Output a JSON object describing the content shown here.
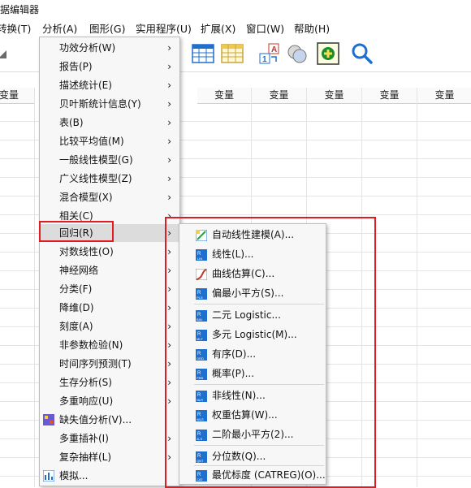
{
  "window": {
    "title": "据编辑器"
  },
  "menubar": {
    "items": [
      "转换(T)",
      "分析(A)",
      "图形(G)",
      "实用程序(U)",
      "扩展(X)",
      "窗口(W)",
      "帮助(H)"
    ]
  },
  "grid": {
    "columns": [
      "变量",
      "变量",
      "变量",
      "变量",
      "变量",
      "变量"
    ]
  },
  "analyze_menu": {
    "items": [
      {
        "label": "功效分析(W)",
        "submenu": true
      },
      {
        "label": "报告(P)",
        "submenu": true
      },
      {
        "label": "描述统计(E)",
        "submenu": true
      },
      {
        "label": "贝叶斯统计信息(Y)",
        "submenu": true
      },
      {
        "label": "表(B)",
        "submenu": true
      },
      {
        "label": "比较平均值(M)",
        "submenu": true
      },
      {
        "label": "一般线性模型(G)",
        "submenu": true
      },
      {
        "label": "广义线性模型(Z)",
        "submenu": true
      },
      {
        "label": "混合模型(X)",
        "submenu": true
      },
      {
        "label": "相关(C)",
        "submenu": true
      },
      {
        "label": "回归(R)",
        "submenu": true,
        "highlighted": true
      },
      {
        "label": "对数线性(O)",
        "submenu": true
      },
      {
        "label": "神经网络",
        "submenu": true
      },
      {
        "label": "分类(F)",
        "submenu": true
      },
      {
        "label": "降维(D)",
        "submenu": true
      },
      {
        "label": "刻度(A)",
        "submenu": true
      },
      {
        "label": "非参数检验(N)",
        "submenu": true
      },
      {
        "label": "时间序列预测(T)",
        "submenu": true
      },
      {
        "label": "生存分析(S)",
        "submenu": true
      },
      {
        "label": "多重响应(U)",
        "submenu": true
      },
      {
        "label": "缺失值分析(V)...",
        "submenu": false,
        "icon": "missing-values-icon"
      },
      {
        "label": "多重插补(I)",
        "submenu": true
      },
      {
        "label": "复杂抽样(L)",
        "submenu": true
      },
      {
        "label": "模拟...",
        "submenu": false,
        "icon": "simulation-icon"
      }
    ]
  },
  "regression_menu": {
    "items": [
      {
        "label": "自动线性建模(A)...",
        "icon": "auto-linear-icon"
      },
      {
        "label": "线性(L)...",
        "icon": "linear-icon"
      },
      {
        "label": "曲线估算(C)...",
        "icon": "curve-estimation-icon"
      },
      {
        "label": "偏最小平方(S)...",
        "icon": "partial-least-squares-icon"
      },
      {
        "label": "二元 Logistic...",
        "icon": "binary-logistic-icon"
      },
      {
        "label": "多元 Logistic(M)...",
        "icon": "multinomial-logistic-icon"
      },
      {
        "label": "有序(D)...",
        "icon": "ordinal-icon"
      },
      {
        "label": "概率(P)...",
        "icon": "probit-icon"
      },
      {
        "label": "非线性(N)...",
        "icon": "nonlinear-icon"
      },
      {
        "label": "权重估算(W)...",
        "icon": "weight-estimation-icon"
      },
      {
        "label": "二阶最小平方(2)...",
        "icon": "two-stage-least-squares-icon"
      },
      {
        "label": "分位数(Q)...",
        "icon": "quantile-icon"
      },
      {
        "label": "最优标度 (CATREG)(O)...",
        "icon": "catreg-icon"
      }
    ]
  },
  "colors": {
    "highlight_border": "#e11b22",
    "menu_bg": "#f7f7f7",
    "hover_bg": "#dcdcdc",
    "icon_blue": "#1f6fcf"
  }
}
